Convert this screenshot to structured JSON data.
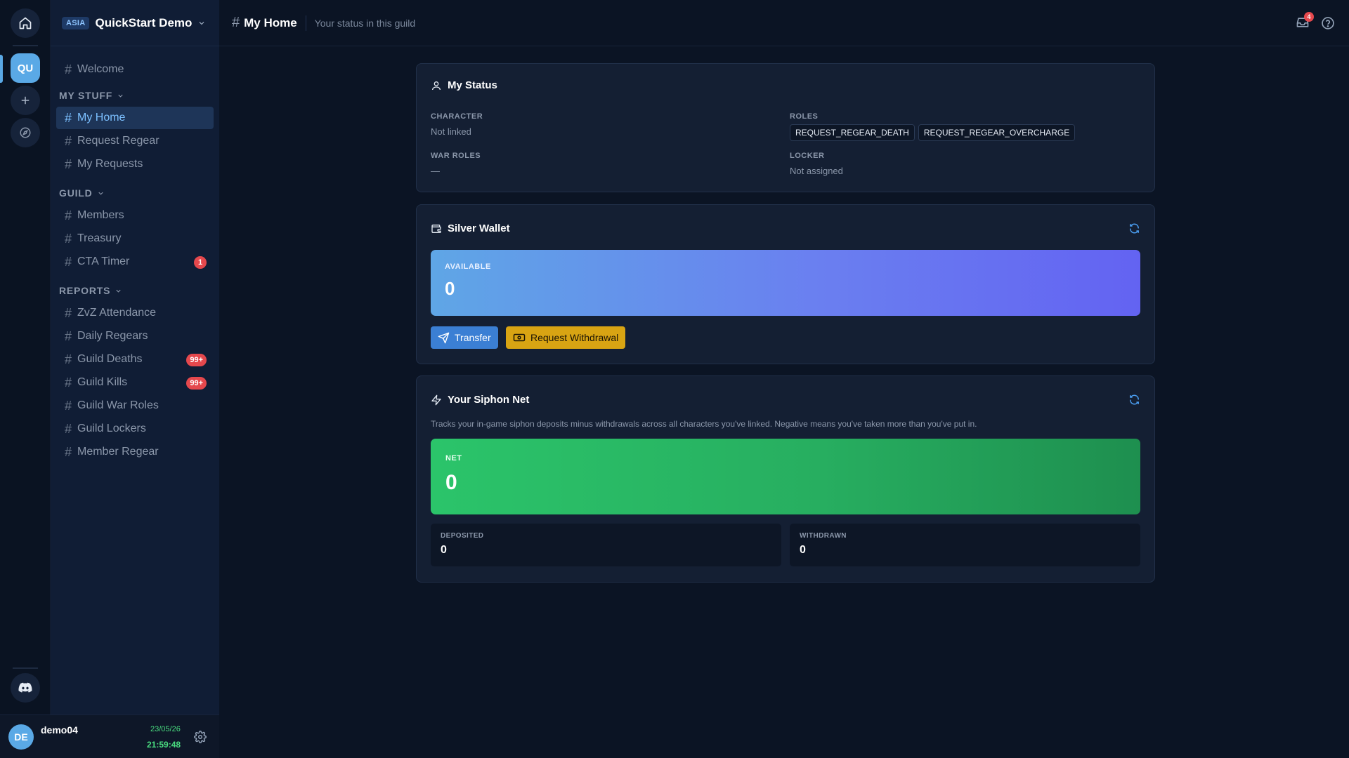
{
  "rail": {
    "server_initials": "QU",
    "icons": [
      "home-icon",
      "plus-icon",
      "compass-icon",
      "discord-icon"
    ]
  },
  "guild": {
    "region": "ASIA",
    "name": "QuickStart Demo"
  },
  "nav": {
    "welcome": "Welcome",
    "sections": [
      {
        "title": "MY STUFF",
        "items": [
          {
            "label": "My Home",
            "active": true
          },
          {
            "label": "Request Regear"
          },
          {
            "label": "My Requests"
          }
        ]
      },
      {
        "title": "GUILD",
        "items": [
          {
            "label": "Members"
          },
          {
            "label": "Treasury"
          },
          {
            "label": "CTA Timer",
            "badge": "1"
          }
        ]
      },
      {
        "title": "REPORTS",
        "items": [
          {
            "label": "ZvZ Attendance"
          },
          {
            "label": "Daily Regears"
          },
          {
            "label": "Guild Deaths",
            "badge": "99+"
          },
          {
            "label": "Guild Kills",
            "badge": "99+"
          },
          {
            "label": "Guild War Roles"
          },
          {
            "label": "Guild Lockers"
          },
          {
            "label": "Member Regear"
          }
        ]
      }
    ]
  },
  "user": {
    "initials": "DE",
    "name": "demo04",
    "date": "23/05/26",
    "time": "21:59:48"
  },
  "header": {
    "title": "My Home",
    "subtitle": "Your status in this guild",
    "inbox_count": "4"
  },
  "status": {
    "title": "My Status",
    "character_label": "CHARACTER",
    "character_value": "Not linked",
    "roles_label": "ROLES",
    "roles": [
      "REQUEST_REGEAR_DEATH",
      "REQUEST_REGEAR_OVERCHARGE"
    ],
    "war_roles_label": "WAR ROLES",
    "war_roles_value": "—",
    "locker_label": "LOCKER",
    "locker_value": "Not assigned"
  },
  "wallet": {
    "title": "Silver Wallet",
    "available_label": "AVAILABLE",
    "available_value": "0",
    "transfer_label": "Transfer",
    "withdraw_label": "Request Withdrawal"
  },
  "siphon": {
    "title": "Your Siphon Net",
    "description": "Tracks your in-game siphon deposits minus withdrawals across all characters you've linked. Negative means you've taken more than you've put in.",
    "net_label": "NET",
    "net_value": "0",
    "deposited_label": "DEPOSITED",
    "deposited_value": "0",
    "withdrawn_label": "WITHDRAWN",
    "withdrawn_value": "0"
  },
  "colors": {
    "accent": "#5aa9e6",
    "badge": "#e5484d",
    "wallet_from": "#5fa6e6",
    "wallet_to": "#6363f2",
    "net_green": "#27ae60",
    "withdraw_button": "#d8a413"
  }
}
